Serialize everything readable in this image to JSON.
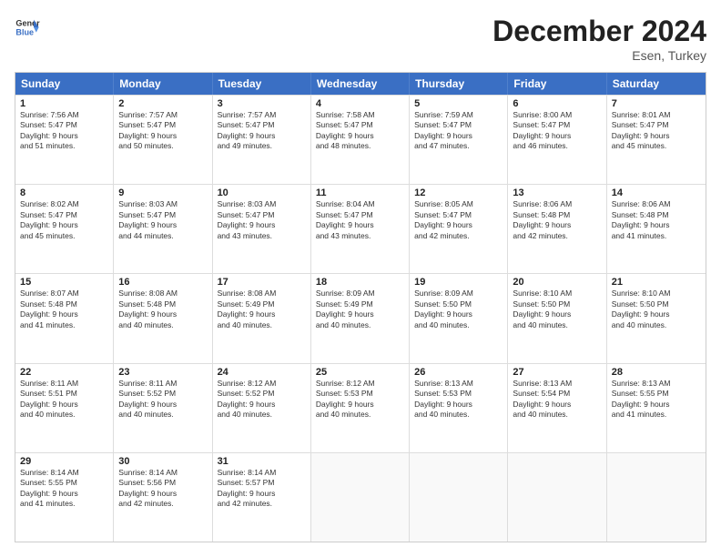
{
  "header": {
    "logo_line1": "General",
    "logo_line2": "Blue",
    "month_title": "December 2024",
    "location": "Esen, Turkey"
  },
  "days_of_week": [
    "Sunday",
    "Monday",
    "Tuesday",
    "Wednesday",
    "Thursday",
    "Friday",
    "Saturday"
  ],
  "weeks": [
    [
      {
        "day": "1",
        "info": "Sunrise: 7:56 AM\nSunset: 5:47 PM\nDaylight: 9 hours\nand 51 minutes."
      },
      {
        "day": "2",
        "info": "Sunrise: 7:57 AM\nSunset: 5:47 PM\nDaylight: 9 hours\nand 50 minutes."
      },
      {
        "day": "3",
        "info": "Sunrise: 7:57 AM\nSunset: 5:47 PM\nDaylight: 9 hours\nand 49 minutes."
      },
      {
        "day": "4",
        "info": "Sunrise: 7:58 AM\nSunset: 5:47 PM\nDaylight: 9 hours\nand 48 minutes."
      },
      {
        "day": "5",
        "info": "Sunrise: 7:59 AM\nSunset: 5:47 PM\nDaylight: 9 hours\nand 47 minutes."
      },
      {
        "day": "6",
        "info": "Sunrise: 8:00 AM\nSunset: 5:47 PM\nDaylight: 9 hours\nand 46 minutes."
      },
      {
        "day": "7",
        "info": "Sunrise: 8:01 AM\nSunset: 5:47 PM\nDaylight: 9 hours\nand 45 minutes."
      }
    ],
    [
      {
        "day": "8",
        "info": "Sunrise: 8:02 AM\nSunset: 5:47 PM\nDaylight: 9 hours\nand 45 minutes."
      },
      {
        "day": "9",
        "info": "Sunrise: 8:03 AM\nSunset: 5:47 PM\nDaylight: 9 hours\nand 44 minutes."
      },
      {
        "day": "10",
        "info": "Sunrise: 8:03 AM\nSunset: 5:47 PM\nDaylight: 9 hours\nand 43 minutes."
      },
      {
        "day": "11",
        "info": "Sunrise: 8:04 AM\nSunset: 5:47 PM\nDaylight: 9 hours\nand 43 minutes."
      },
      {
        "day": "12",
        "info": "Sunrise: 8:05 AM\nSunset: 5:47 PM\nDaylight: 9 hours\nand 42 minutes."
      },
      {
        "day": "13",
        "info": "Sunrise: 8:06 AM\nSunset: 5:48 PM\nDaylight: 9 hours\nand 42 minutes."
      },
      {
        "day": "14",
        "info": "Sunrise: 8:06 AM\nSunset: 5:48 PM\nDaylight: 9 hours\nand 41 minutes."
      }
    ],
    [
      {
        "day": "15",
        "info": "Sunrise: 8:07 AM\nSunset: 5:48 PM\nDaylight: 9 hours\nand 41 minutes."
      },
      {
        "day": "16",
        "info": "Sunrise: 8:08 AM\nSunset: 5:48 PM\nDaylight: 9 hours\nand 40 minutes."
      },
      {
        "day": "17",
        "info": "Sunrise: 8:08 AM\nSunset: 5:49 PM\nDaylight: 9 hours\nand 40 minutes."
      },
      {
        "day": "18",
        "info": "Sunrise: 8:09 AM\nSunset: 5:49 PM\nDaylight: 9 hours\nand 40 minutes."
      },
      {
        "day": "19",
        "info": "Sunrise: 8:09 AM\nSunset: 5:50 PM\nDaylight: 9 hours\nand 40 minutes."
      },
      {
        "day": "20",
        "info": "Sunrise: 8:10 AM\nSunset: 5:50 PM\nDaylight: 9 hours\nand 40 minutes."
      },
      {
        "day": "21",
        "info": "Sunrise: 8:10 AM\nSunset: 5:50 PM\nDaylight: 9 hours\nand 40 minutes."
      }
    ],
    [
      {
        "day": "22",
        "info": "Sunrise: 8:11 AM\nSunset: 5:51 PM\nDaylight: 9 hours\nand 40 minutes."
      },
      {
        "day": "23",
        "info": "Sunrise: 8:11 AM\nSunset: 5:52 PM\nDaylight: 9 hours\nand 40 minutes."
      },
      {
        "day": "24",
        "info": "Sunrise: 8:12 AM\nSunset: 5:52 PM\nDaylight: 9 hours\nand 40 minutes."
      },
      {
        "day": "25",
        "info": "Sunrise: 8:12 AM\nSunset: 5:53 PM\nDaylight: 9 hours\nand 40 minutes."
      },
      {
        "day": "26",
        "info": "Sunrise: 8:13 AM\nSunset: 5:53 PM\nDaylight: 9 hours\nand 40 minutes."
      },
      {
        "day": "27",
        "info": "Sunrise: 8:13 AM\nSunset: 5:54 PM\nDaylight: 9 hours\nand 40 minutes."
      },
      {
        "day": "28",
        "info": "Sunrise: 8:13 AM\nSunset: 5:55 PM\nDaylight: 9 hours\nand 41 minutes."
      }
    ],
    [
      {
        "day": "29",
        "info": "Sunrise: 8:14 AM\nSunset: 5:55 PM\nDaylight: 9 hours\nand 41 minutes."
      },
      {
        "day": "30",
        "info": "Sunrise: 8:14 AM\nSunset: 5:56 PM\nDaylight: 9 hours\nand 42 minutes."
      },
      {
        "day": "31",
        "info": "Sunrise: 8:14 AM\nSunset: 5:57 PM\nDaylight: 9 hours\nand 42 minutes."
      },
      {
        "day": "",
        "info": ""
      },
      {
        "day": "",
        "info": ""
      },
      {
        "day": "",
        "info": ""
      },
      {
        "day": "",
        "info": ""
      }
    ]
  ]
}
